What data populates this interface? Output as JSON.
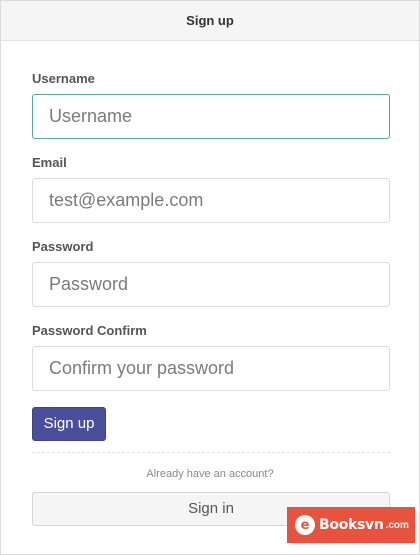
{
  "header": {
    "title": "Sign up"
  },
  "form": {
    "username": {
      "label": "Username",
      "value": "",
      "placeholder": "Username"
    },
    "email": {
      "label": "Email",
      "value": "",
      "placeholder": "test@example.com"
    },
    "password": {
      "label": "Password",
      "value": "",
      "placeholder": "Password"
    },
    "password_confirm": {
      "label": "Password Confirm",
      "value": "",
      "placeholder": "Confirm your password"
    },
    "submit_label": "Sign up"
  },
  "footer": {
    "note": "Already have an account?",
    "signin_label": "Sign in"
  },
  "watermark": {
    "text": "Booksvn",
    "suffix": ".com"
  },
  "colors": {
    "accent": "#4a4f9c",
    "focus_border": "#5aa7a0",
    "watermark_bg": "#e8533e"
  }
}
